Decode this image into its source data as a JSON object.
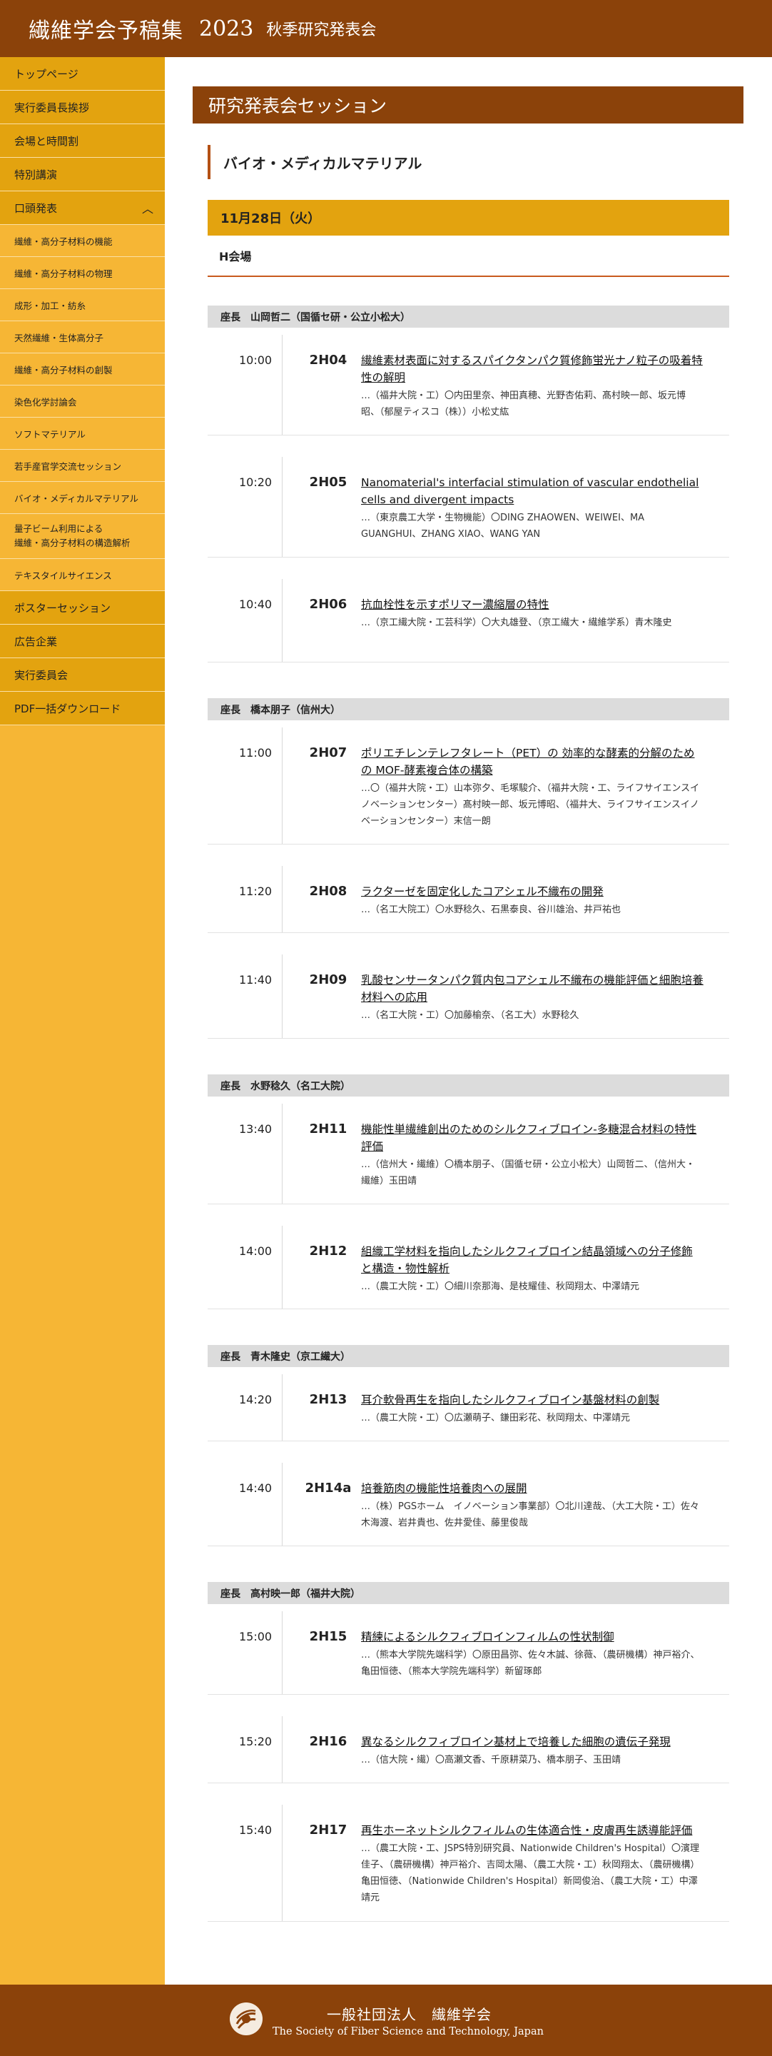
{
  "header": {
    "title": "繊維学会予稿集",
    "year": "2023",
    "subtitle": "秋季研究発表会"
  },
  "sidebar": {
    "items": [
      {
        "label": "トップページ"
      },
      {
        "label": "実行委員長挨拶"
      },
      {
        "label": "会場と時間割"
      },
      {
        "label": "特別講演"
      },
      {
        "label": "口頭発表"
      },
      {
        "label": "繊維・高分子材料の機能"
      },
      {
        "label": "繊維・高分子材料の物理"
      },
      {
        "label": "成形・加工・紡糸"
      },
      {
        "label": "天然繊維・生体高分子"
      },
      {
        "label": "繊維・高分子材料の創製"
      },
      {
        "label": "染色化学討論会"
      },
      {
        "label": "ソフトマテリアル"
      },
      {
        "label": "若手産官学交流セッション"
      },
      {
        "label": "バイオ・メディカルマテリアル"
      },
      {
        "label_line1": "量子ビーム利用による",
        "label_line2": "繊維・高分子材料の構造解析"
      },
      {
        "label": "テキスタイルサイエンス"
      },
      {
        "label": "ポスターセッション"
      },
      {
        "label": "広告企業"
      },
      {
        "label": "実行委員会"
      },
      {
        "label": "PDF一括ダウンロード"
      }
    ],
    "expanded_icon": "chevron-up-icon"
  },
  "main": {
    "section_title": "研究発表会セッション",
    "category": "バイオ・メディカルマテリアル",
    "date": "11月28日（火）",
    "venue": "H会場",
    "chairs": [
      "座長　山岡哲二（国循セ研・公立小松大）",
      "座長　橋本朋子（信州大）",
      "座長　水野稔久（名工大院）",
      "座長　青木隆史（京工繊大）",
      "座長　高村映一郎（福井大院）"
    ],
    "talks": [
      {
        "time": "10:00",
        "code": "2H04",
        "title": "繊維素材表面に対するスパイクタンパク質修飾蛍光ナノ粒子の吸着特性の解明",
        "authors": "…（福井大院・工）〇内田里奈、神田真穂、光野杏佑莉、髙村映一郎、坂元博昭、（郁屋ティスコ（株））小松丈紘"
      },
      {
        "time": "10:20",
        "code": "2H05",
        "title": "Nanomaterial's interfacial stimulation of vascular endothelial cells and divergent impacts",
        "authors": "…（東京農工大学・生物機能）〇DING ZHAOWEN、WEIWEI、MA GUANGHUI、ZHANG XIAO、WANG YAN"
      },
      {
        "time": "10:40",
        "code": "2H06",
        "title": "抗血栓性を示すポリマー濃縮層の特性",
        "authors": "…（京工繊大院・工芸科学）〇大丸雄登、（京工繊大・繊維学系）青木隆史"
      },
      {
        "time": "11:00",
        "code": "2H07",
        "title": "ポリエチレンテレフタレート（PET）の 効率的な酵素的分解のための MOF-酵素複合体の構築",
        "authors": "…〇（福井大院・工）山本弥夕、毛塚駿介、（福井大院・工、ライフサイエンスイノベーションセンター）髙村映一郎、坂元博昭、（福井大、ライフサイエンスイノベーションセンター）末信一朗"
      },
      {
        "time": "11:20",
        "code": "2H08",
        "title": "ラクターゼを固定化したコアシェル不織布の開発",
        "authors": "…（名工大院工）〇水野稔久、石黒泰良、谷川雄治、井戸祐也"
      },
      {
        "time": "11:40",
        "code": "2H09",
        "title": "乳酸センサータンパク質内包コアシェル不織布の機能評価と細胞培養材料への応用",
        "authors": "…（名工大院・工）〇加藤榆奈、（名工大）水野稔久"
      },
      {
        "time": "13:40",
        "code": "2H11",
        "title": "機能性単繊維創出のためのシルクフィブロイン-多糖混合材料の特性評価",
        "authors": "…（信州大・繊維）〇橋本朋子、（国循セ研・公立小松大）山岡哲二、（信州大・繊維）玉田靖"
      },
      {
        "time": "14:00",
        "code": "2H12",
        "title": "組織工学材料を指向したシルクフィブロイン結晶領域への分子修飾と構造・物性解析",
        "authors": "…（農工大院・工）〇細川奈那海、是枝耀佳、秋岡翔太、中澤靖元"
      },
      {
        "time": "14:20",
        "code": "2H13",
        "title": "耳介軟骨再生を指向したシルクフィブロイン基盤材料の創製",
        "authors": "…（農工大院・工）〇広瀬萌子、鎌田彩花、秋岡翔太、中澤靖元"
      },
      {
        "time": "14:40",
        "code": "2H14a",
        "title": "培養筋肉の機能性培養肉への展開",
        "authors": "…（株）PGSホーム　イノベーション事業部）〇北川達哉、（大工大院・工）佐々木海渡、岩井貴也、佐井愛佳、藤里俊哉"
      },
      {
        "time": "15:00",
        "code": "2H15",
        "title": "精練によるシルクフィブロインフィルムの性状制御",
        "authors": "…（熊本大学院先端科学）〇原田昌弥、佐々木誠、徐薇、（農研機構）神戸裕介、亀田恒徳、（熊本大学院先端科学）新留琢郎"
      },
      {
        "time": "15:20",
        "code": "2H16",
        "title": "異なるシルクフィブロイン基材上で培養した細胞の遺伝子発現",
        "authors": "…（信大院・繊）〇高瀬文香、千原耕菜乃、橋本朋子、玉田靖"
      },
      {
        "time": "15:40",
        "code": "2H17",
        "title": "再生ホーネットシルクフィルムの生体適合性・皮膚再生誘導能評価",
        "authors": "…（農工大院・工、JSPS特別研究員、Nationwide Children's Hospital）〇濱理佳子、（農研機構）神戸裕介、吉岡太陽、（農工大院・工）秋岡翔太、（農研機構）亀田恒徳、（Nationwide Children's Hospital）新岡俊治、（農工大院・工）中澤靖元"
      }
    ]
  },
  "footer": {
    "org_name": "一般社団法人　繊維学会",
    "org_name_en": "The Society of Fiber Science and Technology, Japan",
    "logo_icon": "society-logo-icon"
  },
  "colors": {
    "header_bg": "#8b420a",
    "sidebar_bg": "#f6b635",
    "sidebar_main_bg": "#e3a30f",
    "accent": "#c85a1e"
  }
}
